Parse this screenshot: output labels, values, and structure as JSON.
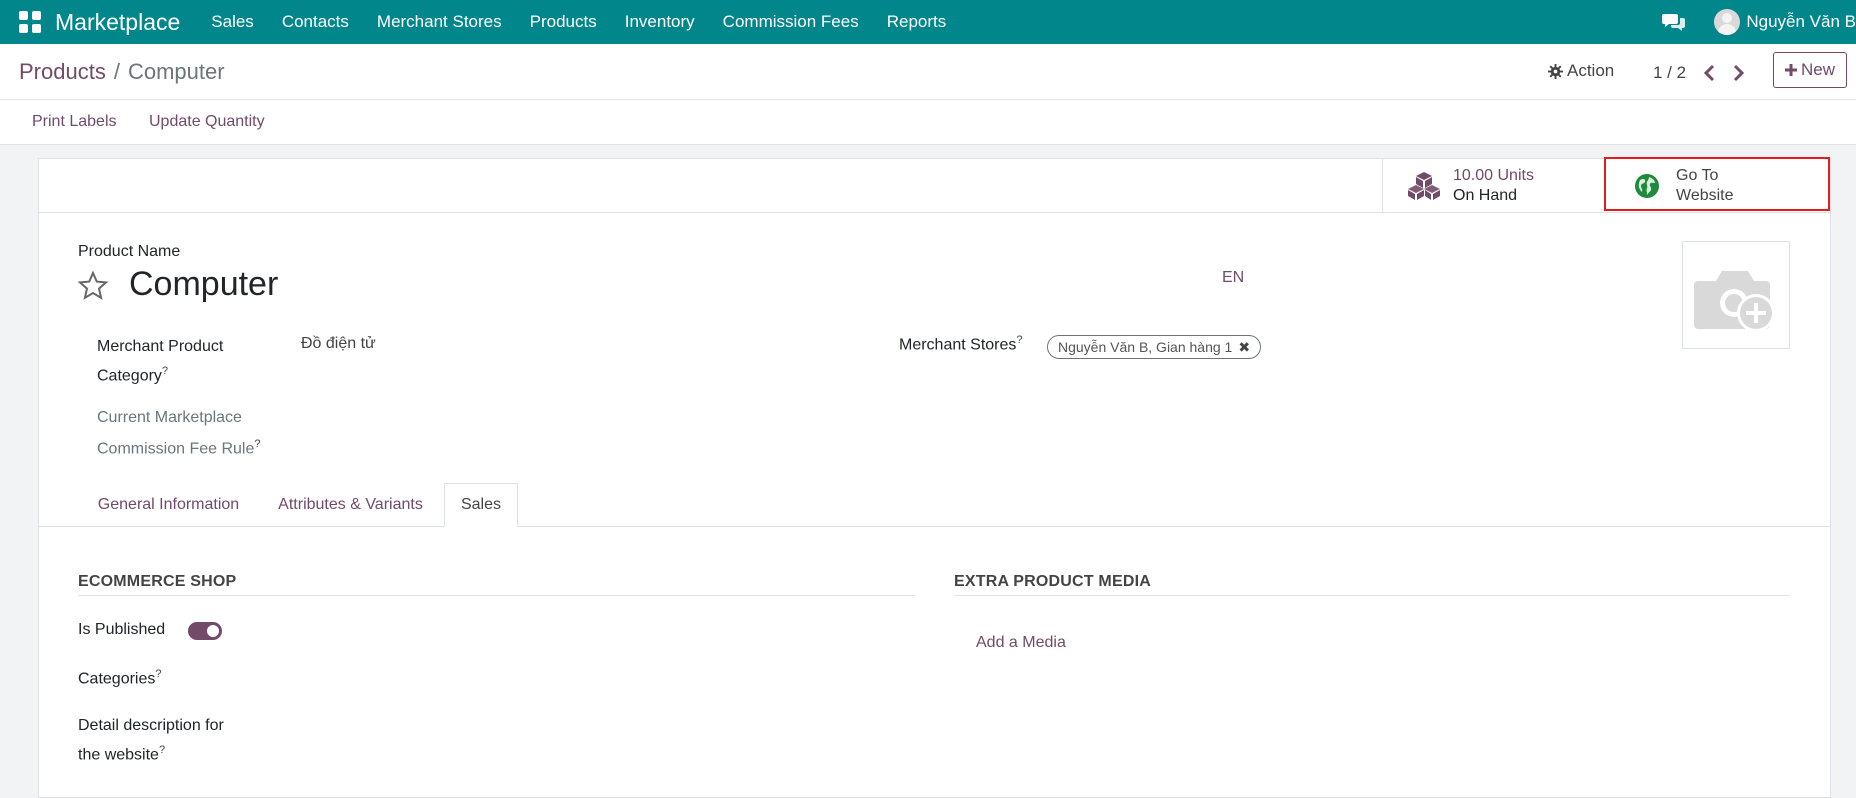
{
  "navbar": {
    "brand": "Marketplace",
    "menu": [
      "Sales",
      "Contacts",
      "Merchant Stores",
      "Products",
      "Inventory",
      "Commission Fees",
      "Reports"
    ],
    "user_name": "Nguyễn Văn B"
  },
  "control_panel": {
    "breadcrumb_parent": "Products",
    "breadcrumb_separator": "/",
    "breadcrumb_current": "Computer",
    "action_label": "Action",
    "pager_value": "1 / 2",
    "new_label": "New",
    "print_labels": "Print Labels",
    "update_quantity": "Update Quantity"
  },
  "smart_buttons": {
    "on_hand_value": "10.00 Units",
    "on_hand_label": "On Hand",
    "website_line1": "Go To",
    "website_line2": "Website"
  },
  "form": {
    "product_name_label": "Product Name",
    "product_name": "Computer",
    "lang": "EN",
    "category_label_line1": "Merchant Product",
    "category_label_line2": "Category",
    "category_value": "Đồ điện tử",
    "commission_label_line1": "Current Marketplace",
    "commission_label_line2": "Commission Fee Rule",
    "stores_label": "Merchant Stores",
    "stores_tag": "Nguyễn Văn B, Gian hàng 1",
    "help_mark": "?"
  },
  "tabs": [
    "General Information",
    "Attributes & Variants",
    "Sales"
  ],
  "active_tab": "Sales",
  "sales_tab": {
    "ecommerce_title": "ECOMMERCE SHOP",
    "is_published_label": "Is Published",
    "is_published": true,
    "categories_label": "Categories",
    "description_label_line1": "Detail description for",
    "description_label_line2": "the website",
    "media_title": "EXTRA PRODUCT MEDIA",
    "add_media": "Add a Media"
  },
  "colors": {
    "navbar": "#01868c",
    "primary": "#714b67",
    "highlight": "#e51c1c",
    "globe": "#1f8a3a"
  }
}
